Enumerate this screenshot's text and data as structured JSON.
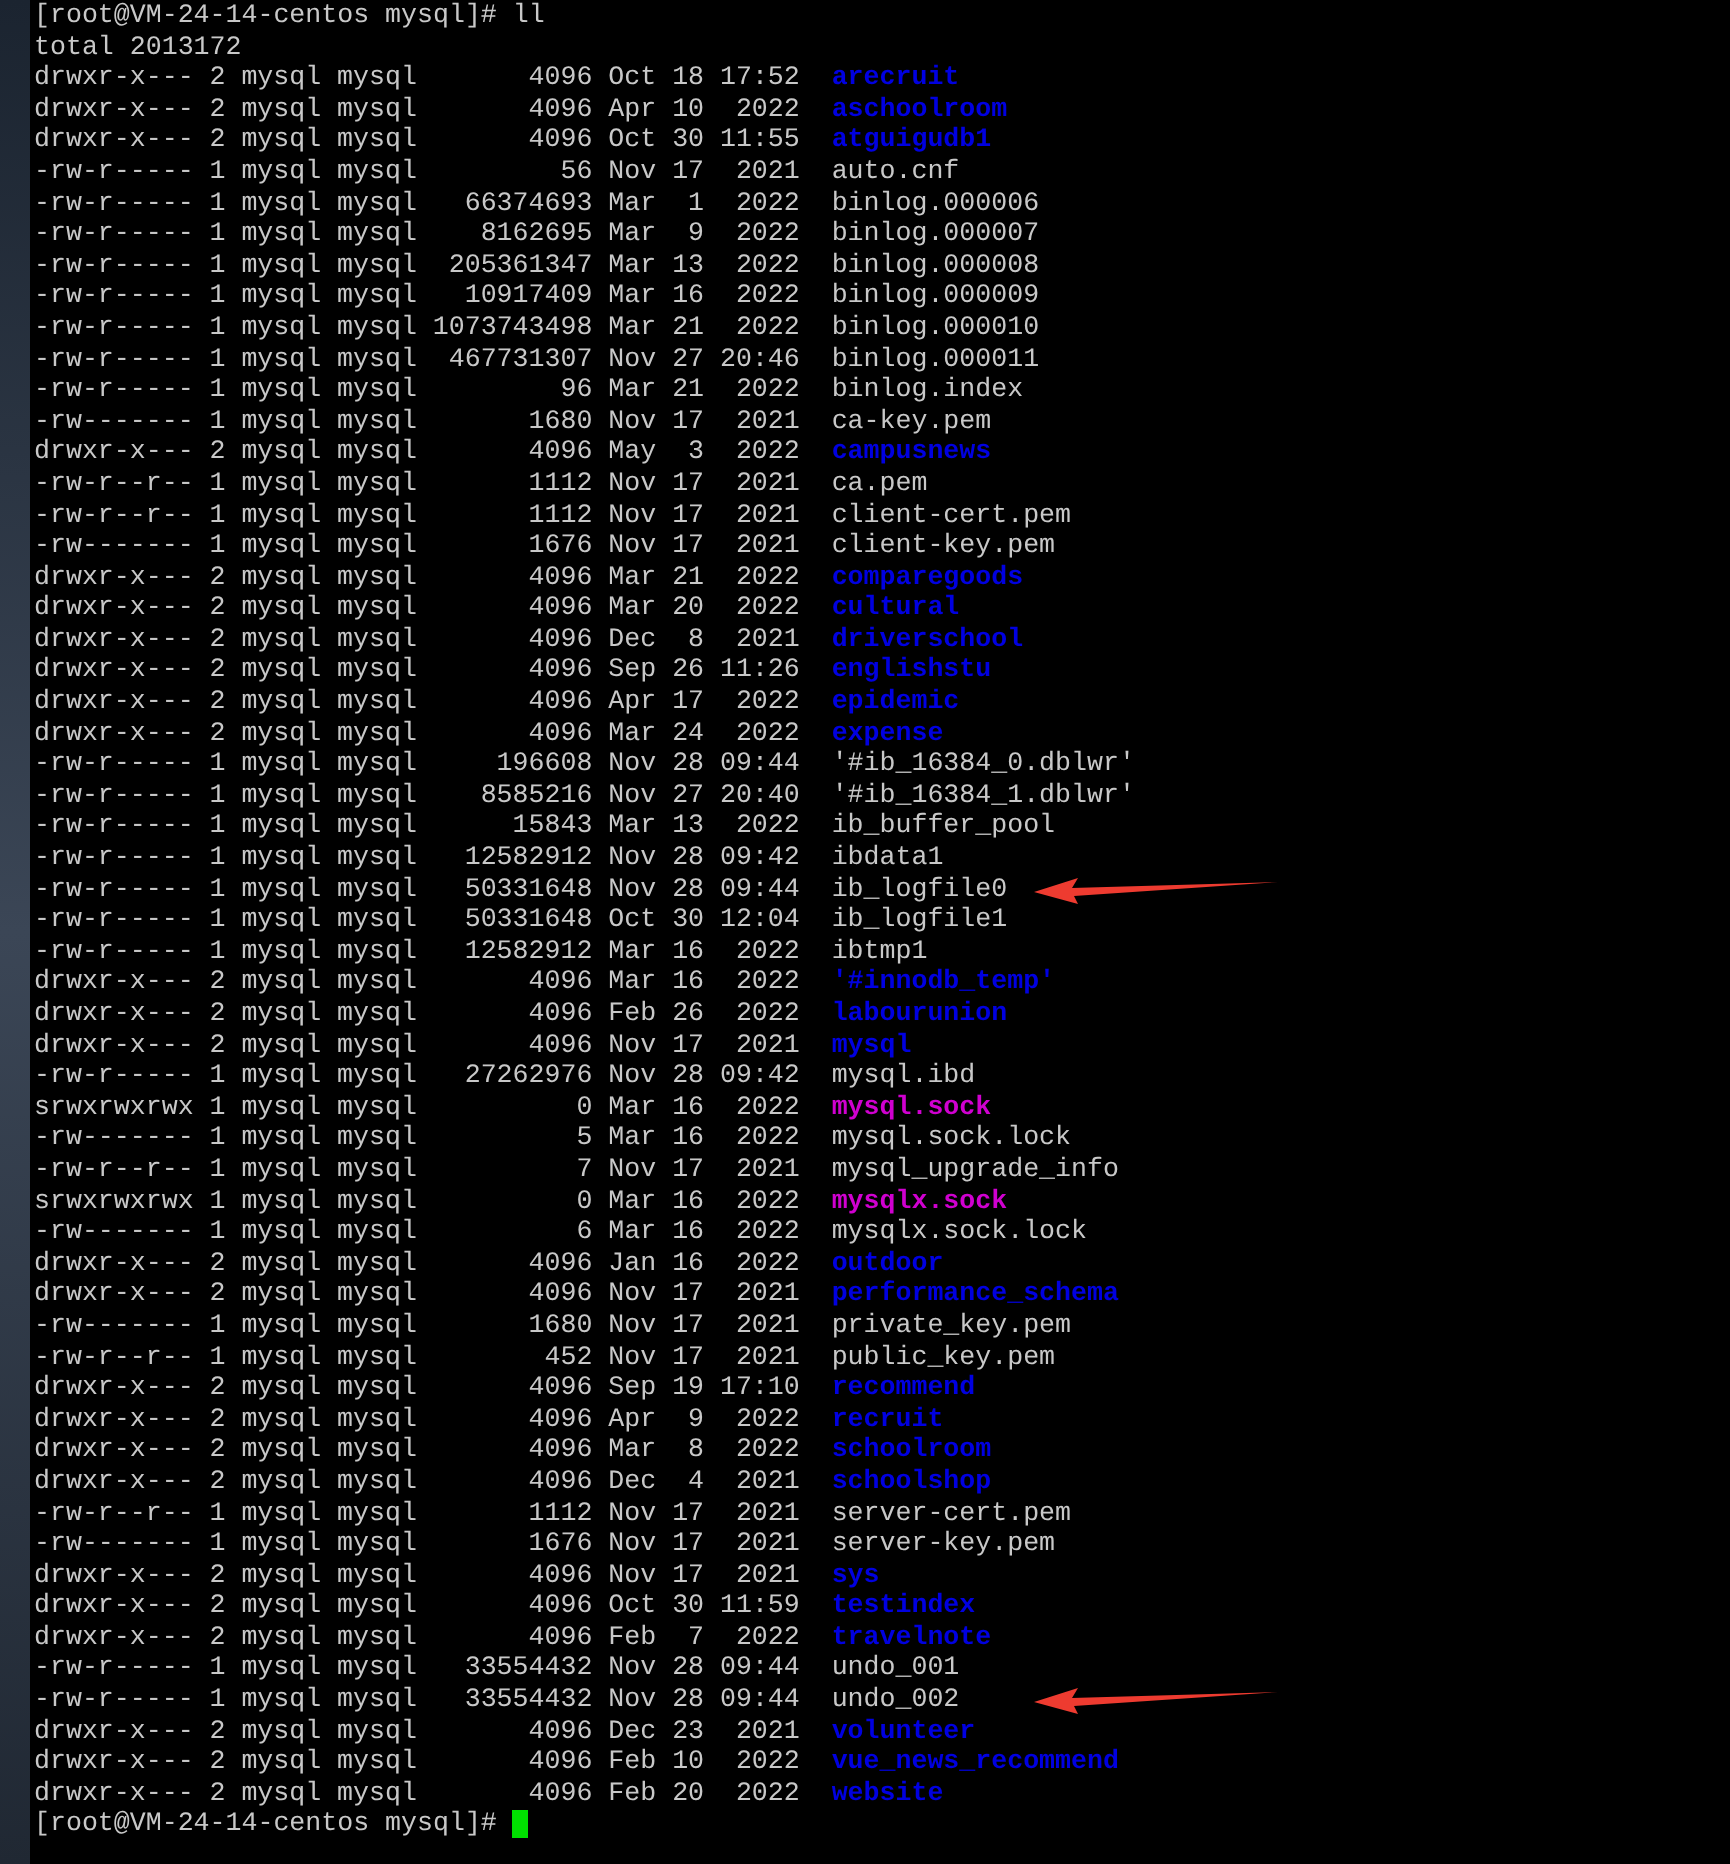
{
  "terminal": {
    "command_line": "[root@VM-24-14-centos mysql]# ll",
    "total": "total 2013172",
    "rows": [
      {
        "perms": "drwxr-x---",
        "links": "2",
        "owner": "mysql",
        "group": "mysql",
        "size": "4096",
        "month": "Oct",
        "day": "18",
        "time": "17:52",
        "name": "arecruit",
        "kind": "dir"
      },
      {
        "perms": "drwxr-x---",
        "links": "2",
        "owner": "mysql",
        "group": "mysql",
        "size": "4096",
        "month": "Apr",
        "day": "10",
        "time": "2022",
        "name": "aschoolroom",
        "kind": "dir"
      },
      {
        "perms": "drwxr-x---",
        "links": "2",
        "owner": "mysql",
        "group": "mysql",
        "size": "4096",
        "month": "Oct",
        "day": "30",
        "time": "11:55",
        "name": "atguigudb1",
        "kind": "dir"
      },
      {
        "perms": "-rw-r-----",
        "links": "1",
        "owner": "mysql",
        "group": "mysql",
        "size": "56",
        "month": "Nov",
        "day": "17",
        "time": "2021",
        "name": "auto.cnf",
        "kind": "file"
      },
      {
        "perms": "-rw-r-----",
        "links": "1",
        "owner": "mysql",
        "group": "mysql",
        "size": "66374693",
        "month": "Mar",
        "day": "1",
        "time": "2022",
        "name": "binlog.000006",
        "kind": "file"
      },
      {
        "perms": "-rw-r-----",
        "links": "1",
        "owner": "mysql",
        "group": "mysql",
        "size": "8162695",
        "month": "Mar",
        "day": "9",
        "time": "2022",
        "name": "binlog.000007",
        "kind": "file"
      },
      {
        "perms": "-rw-r-----",
        "links": "1",
        "owner": "mysql",
        "group": "mysql",
        "size": "205361347",
        "month": "Mar",
        "day": "13",
        "time": "2022",
        "name": "binlog.000008",
        "kind": "file"
      },
      {
        "perms": "-rw-r-----",
        "links": "1",
        "owner": "mysql",
        "group": "mysql",
        "size": "10917409",
        "month": "Mar",
        "day": "16",
        "time": "2022",
        "name": "binlog.000009",
        "kind": "file"
      },
      {
        "perms": "-rw-r-----",
        "links": "1",
        "owner": "mysql",
        "group": "mysql",
        "size": "1073743498",
        "month": "Mar",
        "day": "21",
        "time": "2022",
        "name": "binlog.000010",
        "kind": "file"
      },
      {
        "perms": "-rw-r-----",
        "links": "1",
        "owner": "mysql",
        "group": "mysql",
        "size": "467731307",
        "month": "Nov",
        "day": "27",
        "time": "20:46",
        "name": "binlog.000011",
        "kind": "file"
      },
      {
        "perms": "-rw-r-----",
        "links": "1",
        "owner": "mysql",
        "group": "mysql",
        "size": "96",
        "month": "Mar",
        "day": "21",
        "time": "2022",
        "name": "binlog.index",
        "kind": "file"
      },
      {
        "perms": "-rw-------",
        "links": "1",
        "owner": "mysql",
        "group": "mysql",
        "size": "1680",
        "month": "Nov",
        "day": "17",
        "time": "2021",
        "name": "ca-key.pem",
        "kind": "file"
      },
      {
        "perms": "drwxr-x---",
        "links": "2",
        "owner": "mysql",
        "group": "mysql",
        "size": "4096",
        "month": "May",
        "day": "3",
        "time": "2022",
        "name": "campusnews",
        "kind": "dir"
      },
      {
        "perms": "-rw-r--r--",
        "links": "1",
        "owner": "mysql",
        "group": "mysql",
        "size": "1112",
        "month": "Nov",
        "day": "17",
        "time": "2021",
        "name": "ca.pem",
        "kind": "file"
      },
      {
        "perms": "-rw-r--r--",
        "links": "1",
        "owner": "mysql",
        "group": "mysql",
        "size": "1112",
        "month": "Nov",
        "day": "17",
        "time": "2021",
        "name": "client-cert.pem",
        "kind": "file"
      },
      {
        "perms": "-rw-------",
        "links": "1",
        "owner": "mysql",
        "group": "mysql",
        "size": "1676",
        "month": "Nov",
        "day": "17",
        "time": "2021",
        "name": "client-key.pem",
        "kind": "file"
      },
      {
        "perms": "drwxr-x---",
        "links": "2",
        "owner": "mysql",
        "group": "mysql",
        "size": "4096",
        "month": "Mar",
        "day": "21",
        "time": "2022",
        "name": "comparegoods",
        "kind": "dir"
      },
      {
        "perms": "drwxr-x---",
        "links": "2",
        "owner": "mysql",
        "group": "mysql",
        "size": "4096",
        "month": "Mar",
        "day": "20",
        "time": "2022",
        "name": "cultural",
        "kind": "dir"
      },
      {
        "perms": "drwxr-x---",
        "links": "2",
        "owner": "mysql",
        "group": "mysql",
        "size": "4096",
        "month": "Dec",
        "day": "8",
        "time": "2021",
        "name": "driverschool",
        "kind": "dir"
      },
      {
        "perms": "drwxr-x---",
        "links": "2",
        "owner": "mysql",
        "group": "mysql",
        "size": "4096",
        "month": "Sep",
        "day": "26",
        "time": "11:26",
        "name": "englishstu",
        "kind": "dir"
      },
      {
        "perms": "drwxr-x---",
        "links": "2",
        "owner": "mysql",
        "group": "mysql",
        "size": "4096",
        "month": "Apr",
        "day": "17",
        "time": "2022",
        "name": "epidemic",
        "kind": "dir"
      },
      {
        "perms": "drwxr-x---",
        "links": "2",
        "owner": "mysql",
        "group": "mysql",
        "size": "4096",
        "month": "Mar",
        "day": "24",
        "time": "2022",
        "name": "expense",
        "kind": "dir"
      },
      {
        "perms": "-rw-r-----",
        "links": "1",
        "owner": "mysql",
        "group": "mysql",
        "size": "196608",
        "month": "Nov",
        "day": "28",
        "time": "09:44",
        "name": "'#ib_16384_0.dblwr'",
        "kind": "file"
      },
      {
        "perms": "-rw-r-----",
        "links": "1",
        "owner": "mysql",
        "group": "mysql",
        "size": "8585216",
        "month": "Nov",
        "day": "27",
        "time": "20:40",
        "name": "'#ib_16384_1.dblwr'",
        "kind": "file"
      },
      {
        "perms": "-rw-r-----",
        "links": "1",
        "owner": "mysql",
        "group": "mysql",
        "size": "15843",
        "month": "Mar",
        "day": "13",
        "time": "2022",
        "name": "ib_buffer_pool",
        "kind": "file"
      },
      {
        "perms": "-rw-r-----",
        "links": "1",
        "owner": "mysql",
        "group": "mysql",
        "size": "12582912",
        "month": "Nov",
        "day": "28",
        "time": "09:42",
        "name": "ibdata1",
        "kind": "file"
      },
      {
        "perms": "-rw-r-----",
        "links": "1",
        "owner": "mysql",
        "group": "mysql",
        "size": "50331648",
        "month": "Nov",
        "day": "28",
        "time": "09:44",
        "name": "ib_logfile0",
        "kind": "file",
        "arrow": true
      },
      {
        "perms": "-rw-r-----",
        "links": "1",
        "owner": "mysql",
        "group": "mysql",
        "size": "50331648",
        "month": "Oct",
        "day": "30",
        "time": "12:04",
        "name": "ib_logfile1",
        "kind": "file"
      },
      {
        "perms": "-rw-r-----",
        "links": "1",
        "owner": "mysql",
        "group": "mysql",
        "size": "12582912",
        "month": "Mar",
        "day": "16",
        "time": "2022",
        "name": "ibtmp1",
        "kind": "file"
      },
      {
        "perms": "drwxr-x---",
        "links": "2",
        "owner": "mysql",
        "group": "mysql",
        "size": "4096",
        "month": "Mar",
        "day": "16",
        "time": "2022",
        "name": "'#innodb_temp'",
        "kind": "dir"
      },
      {
        "perms": "drwxr-x---",
        "links": "2",
        "owner": "mysql",
        "group": "mysql",
        "size": "4096",
        "month": "Feb",
        "day": "26",
        "time": "2022",
        "name": "labourunion",
        "kind": "dir"
      },
      {
        "perms": "drwxr-x---",
        "links": "2",
        "owner": "mysql",
        "group": "mysql",
        "size": "4096",
        "month": "Nov",
        "day": "17",
        "time": "2021",
        "name": "mysql",
        "kind": "dir"
      },
      {
        "perms": "-rw-r-----",
        "links": "1",
        "owner": "mysql",
        "group": "mysql",
        "size": "27262976",
        "month": "Nov",
        "day": "28",
        "time": "09:42",
        "name": "mysql.ibd",
        "kind": "file"
      },
      {
        "perms": "srwxrwxrwx",
        "links": "1",
        "owner": "mysql",
        "group": "mysql",
        "size": "0",
        "month": "Mar",
        "day": "16",
        "time": "2022",
        "name": "mysql.sock",
        "kind": "socket"
      },
      {
        "perms": "-rw-------",
        "links": "1",
        "owner": "mysql",
        "group": "mysql",
        "size": "5",
        "month": "Mar",
        "day": "16",
        "time": "2022",
        "name": "mysql.sock.lock",
        "kind": "file"
      },
      {
        "perms": "-rw-r--r--",
        "links": "1",
        "owner": "mysql",
        "group": "mysql",
        "size": "7",
        "month": "Nov",
        "day": "17",
        "time": "2021",
        "name": "mysql_upgrade_info",
        "kind": "file"
      },
      {
        "perms": "srwxrwxrwx",
        "links": "1",
        "owner": "mysql",
        "group": "mysql",
        "size": "0",
        "month": "Mar",
        "day": "16",
        "time": "2022",
        "name": "mysqlx.sock",
        "kind": "socket"
      },
      {
        "perms": "-rw-------",
        "links": "1",
        "owner": "mysql",
        "group": "mysql",
        "size": "6",
        "month": "Mar",
        "day": "16",
        "time": "2022",
        "name": "mysqlx.sock.lock",
        "kind": "file"
      },
      {
        "perms": "drwxr-x---",
        "links": "2",
        "owner": "mysql",
        "group": "mysql",
        "size": "4096",
        "month": "Jan",
        "day": "16",
        "time": "2022",
        "name": "outdoor",
        "kind": "dir"
      },
      {
        "perms": "drwxr-x---",
        "links": "2",
        "owner": "mysql",
        "group": "mysql",
        "size": "4096",
        "month": "Nov",
        "day": "17",
        "time": "2021",
        "name": "performance_schema",
        "kind": "dir"
      },
      {
        "perms": "-rw-------",
        "links": "1",
        "owner": "mysql",
        "group": "mysql",
        "size": "1680",
        "month": "Nov",
        "day": "17",
        "time": "2021",
        "name": "private_key.pem",
        "kind": "file"
      },
      {
        "perms": "-rw-r--r--",
        "links": "1",
        "owner": "mysql",
        "group": "mysql",
        "size": "452",
        "month": "Nov",
        "day": "17",
        "time": "2021",
        "name": "public_key.pem",
        "kind": "file"
      },
      {
        "perms": "drwxr-x---",
        "links": "2",
        "owner": "mysql",
        "group": "mysql",
        "size": "4096",
        "month": "Sep",
        "day": "19",
        "time": "17:10",
        "name": "recommend",
        "kind": "dir"
      },
      {
        "perms": "drwxr-x---",
        "links": "2",
        "owner": "mysql",
        "group": "mysql",
        "size": "4096",
        "month": "Apr",
        "day": "9",
        "time": "2022",
        "name": "recruit",
        "kind": "dir"
      },
      {
        "perms": "drwxr-x---",
        "links": "2",
        "owner": "mysql",
        "group": "mysql",
        "size": "4096",
        "month": "Mar",
        "day": "8",
        "time": "2022",
        "name": "schoolroom",
        "kind": "dir"
      },
      {
        "perms": "drwxr-x---",
        "links": "2",
        "owner": "mysql",
        "group": "mysql",
        "size": "4096",
        "month": "Dec",
        "day": "4",
        "time": "2021",
        "name": "schoolshop",
        "kind": "dir"
      },
      {
        "perms": "-rw-r--r--",
        "links": "1",
        "owner": "mysql",
        "group": "mysql",
        "size": "1112",
        "month": "Nov",
        "day": "17",
        "time": "2021",
        "name": "server-cert.pem",
        "kind": "file"
      },
      {
        "perms": "-rw-------",
        "links": "1",
        "owner": "mysql",
        "group": "mysql",
        "size": "1676",
        "month": "Nov",
        "day": "17",
        "time": "2021",
        "name": "server-key.pem",
        "kind": "file"
      },
      {
        "perms": "drwxr-x---",
        "links": "2",
        "owner": "mysql",
        "group": "mysql",
        "size": "4096",
        "month": "Nov",
        "day": "17",
        "time": "2021",
        "name": "sys",
        "kind": "dir"
      },
      {
        "perms": "drwxr-x---",
        "links": "2",
        "owner": "mysql",
        "group": "mysql",
        "size": "4096",
        "month": "Oct",
        "day": "30",
        "time": "11:59",
        "name": "testindex",
        "kind": "dir"
      },
      {
        "perms": "drwxr-x---",
        "links": "2",
        "owner": "mysql",
        "group": "mysql",
        "size": "4096",
        "month": "Feb",
        "day": "7",
        "time": "2022",
        "name": "travelnote",
        "kind": "dir"
      },
      {
        "perms": "-rw-r-----",
        "links": "1",
        "owner": "mysql",
        "group": "mysql",
        "size": "33554432",
        "month": "Nov",
        "day": "28",
        "time": "09:44",
        "name": "undo_001",
        "kind": "file"
      },
      {
        "perms": "-rw-r-----",
        "links": "1",
        "owner": "mysql",
        "group": "mysql",
        "size": "33554432",
        "month": "Nov",
        "day": "28",
        "time": "09:44",
        "name": "undo_002",
        "kind": "file",
        "arrow": true
      },
      {
        "perms": "drwxr-x---",
        "links": "2",
        "owner": "mysql",
        "group": "mysql",
        "size": "4096",
        "month": "Dec",
        "day": "23",
        "time": "2021",
        "name": "volunteer",
        "kind": "dir"
      },
      {
        "perms": "drwxr-x---",
        "links": "2",
        "owner": "mysql",
        "group": "mysql",
        "size": "4096",
        "month": "Feb",
        "day": "10",
        "time": "2022",
        "name": "vue_news_recommend",
        "kind": "dir"
      },
      {
        "perms": "drwxr-x---",
        "links": "2",
        "owner": "mysql",
        "group": "mysql",
        "size": "4096",
        "month": "Feb",
        "day": "20",
        "time": "2022",
        "name": "website",
        "kind": "dir"
      }
    ],
    "prompt": "[root@VM-24-14-centos mysql]#"
  }
}
